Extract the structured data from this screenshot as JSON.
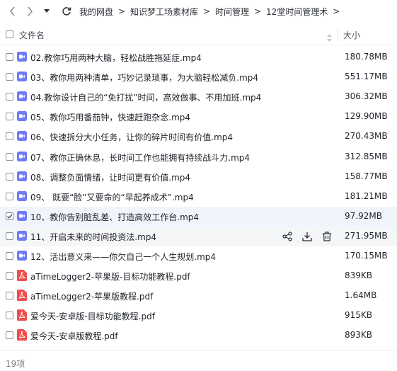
{
  "nav": {
    "breadcrumbs": [
      "我的网盘",
      "知识梦工场素材库",
      "时间管理",
      "12堂时间管理术"
    ]
  },
  "header": {
    "name_label": "文件名",
    "size_label": "大小"
  },
  "files": [
    {
      "name": "02.教你巧用两种大脑，轻松战胜拖延症.mp4",
      "size": "180.78MB",
      "type": "video"
    },
    {
      "name": "03、教你用两种清单，巧妙记录琐事，为大脑轻松减负.mp4",
      "size": "551.17MB",
      "type": "video"
    },
    {
      "name": "04.教你设计自己的“免打扰”时间，高效做事、不用加班.mp4",
      "size": "306.32MB",
      "type": "video"
    },
    {
      "name": "05、教你巧用番茄钟，快速赶跑杂念.mp4",
      "size": "129.90MB",
      "type": "video"
    },
    {
      "name": "06、快速拆分大小任务，让你的碎片时间有价值.mp4",
      "size": "270.43MB",
      "type": "video"
    },
    {
      "name": "07、教你正确休息，长时间工作也能拥有持续战斗力.mp4",
      "size": "312.85MB",
      "type": "video"
    },
    {
      "name": "08、调整负面情绪，让时间更有价值.mp4",
      "size": "158.77MB",
      "type": "video"
    },
    {
      "name": "09、 既要“脸”又要命的“早起养成术”.mp4",
      "size": "181.21MB",
      "type": "video"
    },
    {
      "name": "10、教你告别脏乱差、打造高效工作台.mp4",
      "size": "97.92MB",
      "type": "video"
    },
    {
      "name": "11、开启未来的时间投资法.mp4",
      "size": "271.95MB",
      "type": "video"
    },
    {
      "name": "12、活出意义来——你欠自己一个人生规划.mp4",
      "size": "170.15MB",
      "type": "video"
    },
    {
      "name": "aTimeLogger2-苹果版-目标功能教程.pdf",
      "size": "839KB",
      "type": "pdf"
    },
    {
      "name": "aTimeLogger2-苹果版教程.pdf",
      "size": "1.64MB",
      "type": "pdf"
    },
    {
      "name": "爱今天-安卓版-目标功能教程.pdf",
      "size": "915KB",
      "type": "pdf"
    },
    {
      "name": "爱今天-安卓版教程.pdf",
      "size": "893KB",
      "type": "pdf"
    }
  ],
  "footer": {
    "count_label": "19项"
  },
  "colors": {
    "video_icon": "#6f7bf7",
    "pdf_icon": "#f24e4e",
    "selected_row": "#f1f4fb"
  },
  "icons": {
    "back": "chevron-left-icon",
    "forward": "chevron-right-icon",
    "history": "caret-down-icon",
    "refresh": "refresh-icon",
    "share": "share-icon",
    "download": "download-icon",
    "delete": "trash-icon"
  },
  "selected_index": 8,
  "hover_index": 9
}
